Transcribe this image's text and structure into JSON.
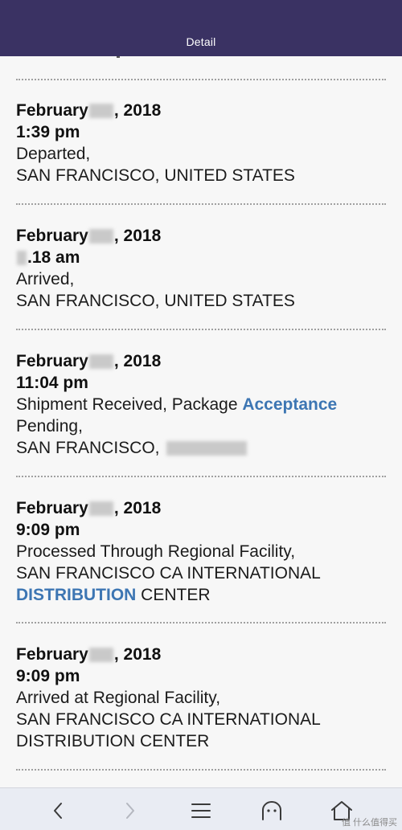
{
  "header": {
    "title": "Detail"
  },
  "entries": [
    {
      "date_prefix": "February",
      "date_suffix": ", 2018",
      "time": "1:39 pm",
      "status": "Departed,",
      "location": "SAN FRANCISCO, UNITED STATES"
    },
    {
      "date_prefix": "February",
      "date_suffix": ", 2018",
      "time_suffix": ".18 am",
      "status": "Arrived,",
      "location": "SAN FRANCISCO, UNITED STATES"
    },
    {
      "date_prefix": "February",
      "date_suffix": ", 2018",
      "time": "11:04 pm",
      "status_prefix": "Shipment Received, Package ",
      "status_highlight": "Acceptance",
      "status_cont": "Pending,",
      "location": "SAN FRANCISCO,"
    },
    {
      "date_prefix": "February",
      "date_suffix": ", 2018",
      "time": "9:09 pm",
      "status": "Processed Through Regional Facility,",
      "location_line1": "SAN FRANCISCO CA INTERNATIONAL",
      "location_highlight": "DISTRIBUTION",
      "location_line2_suffix": " CENTER"
    },
    {
      "date_prefix": "February",
      "date_suffix": ", 2018",
      "time": "9:09 pm",
      "status": "Arrived at Regional Facility,",
      "location_line1": "SAN FRANCISCO CA INTERNATIONAL",
      "location_line2": "DISTRIBUTION CENTER"
    }
  ],
  "toolbar": {
    "back_icon": "chevron-left-icon",
    "forward_icon": "chevron-right-icon",
    "menu_icon": "menu-icon",
    "bookmark_icon": "ghost-icon",
    "home_icon": "home-icon"
  },
  "watermark": "值 什么值得买",
  "colors": {
    "header_bg": "#3a3263",
    "highlight": "#3d76b3",
    "bottom_bar": "#e9ecf3"
  }
}
